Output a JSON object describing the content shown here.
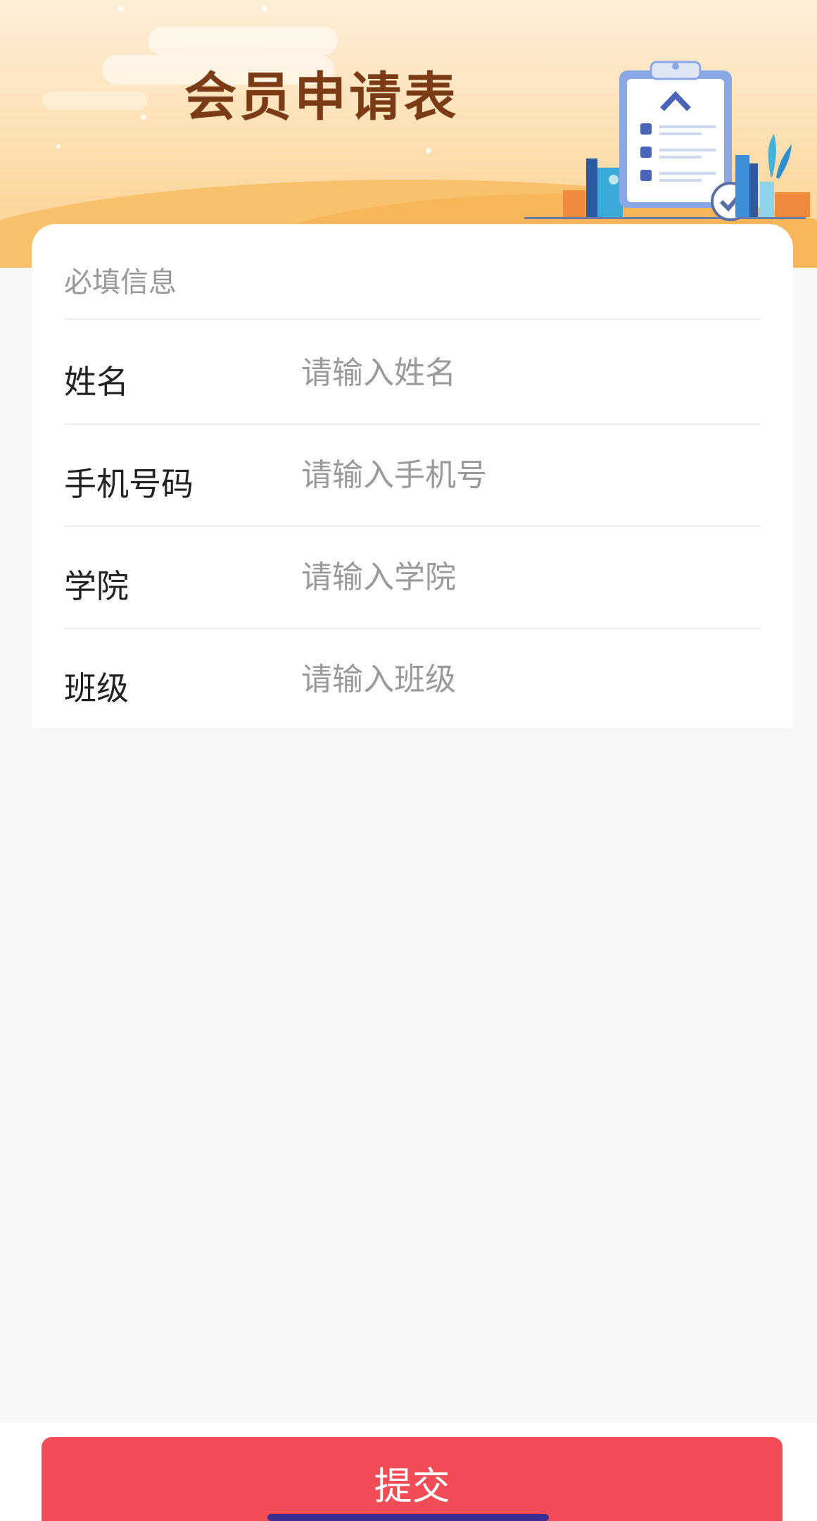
{
  "header": {
    "title": "会员申请表",
    "illustration_icon": "clipboard-checklist-icon",
    "colors": {
      "banner_top": "#fdeed7",
      "banner_bottom": "#f7b65a",
      "title": "#7a3b16"
    }
  },
  "form": {
    "section_title": "必填信息",
    "fields": [
      {
        "label": "姓名",
        "placeholder": "请输入姓名",
        "value": ""
      },
      {
        "label": "手机号码",
        "placeholder": "请输入手机号",
        "value": ""
      },
      {
        "label": "学院",
        "placeholder": "请输入学院",
        "value": ""
      },
      {
        "label": "班级",
        "placeholder": "请输入班级",
        "value": ""
      }
    ]
  },
  "footer": {
    "submit_label": "提交",
    "accent_color": "#f24c56"
  }
}
